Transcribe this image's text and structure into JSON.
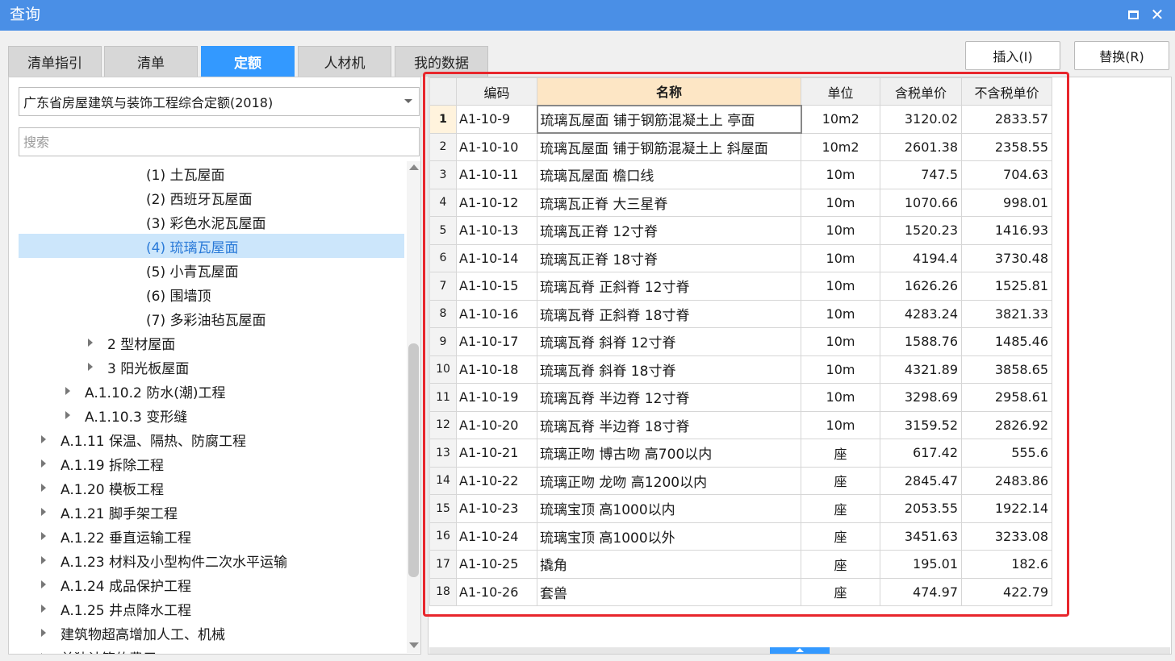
{
  "window": {
    "title": "查询"
  },
  "tabs": [
    {
      "label": "清单指引"
    },
    {
      "label": "清单"
    },
    {
      "label": "定额",
      "active": true
    },
    {
      "label": "人材机"
    },
    {
      "label": "我的数据"
    }
  ],
  "toolbar": {
    "insert_label": "插入(I)",
    "replace_label": "替换(R)"
  },
  "left": {
    "quota_library": "广东省房屋建筑与装饰工程综合定额(2018)",
    "search_placeholder": "搜索",
    "tree": [
      {
        "label": "(1) 土瓦屋面",
        "level": 3,
        "expandable": false
      },
      {
        "label": "(2) 西班牙瓦屋面",
        "level": 3,
        "expandable": false
      },
      {
        "label": "(3) 彩色水泥瓦屋面",
        "level": 3,
        "expandable": false
      },
      {
        "label": "(4) 琉璃瓦屋面",
        "level": 3,
        "expandable": false,
        "selected": true
      },
      {
        "label": "(5) 小青瓦屋面",
        "level": 3,
        "expandable": false
      },
      {
        "label": "(6) 围墙顶",
        "level": 3,
        "expandable": false
      },
      {
        "label": "(7) 多彩油毡瓦屋面",
        "level": 3,
        "expandable": false
      },
      {
        "label": "2 型材屋面",
        "level": 2,
        "expandable": true
      },
      {
        "label": "3 阳光板屋面",
        "level": 2,
        "expandable": true
      },
      {
        "label": "A.1.10.2 防水(潮)工程",
        "level": 1,
        "expandable": true
      },
      {
        "label": "A.1.10.3 变形缝",
        "level": 1,
        "expandable": true
      },
      {
        "label": "A.1.11 保温、隔热、防腐工程",
        "level": 0,
        "expandable": true
      },
      {
        "label": "A.1.19 拆除工程",
        "level": 0,
        "expandable": true
      },
      {
        "label": "A.1.20 模板工程",
        "level": 0,
        "expandable": true
      },
      {
        "label": "A.1.21 脚手架工程",
        "level": 0,
        "expandable": true
      },
      {
        "label": "A.1.22 垂直运输工程",
        "level": 0,
        "expandable": true
      },
      {
        "label": "A.1.23 材料及小型构件二次水平运输",
        "level": 0,
        "expandable": true
      },
      {
        "label": "A.1.24 成品保护工程",
        "level": 0,
        "expandable": true
      },
      {
        "label": "A.1.25 井点降水工程",
        "level": 0,
        "expandable": true
      },
      {
        "label": "建筑物超高增加人工、机械",
        "level": 0,
        "expandable": true
      },
      {
        "label": "单独计算的费用",
        "level": 0,
        "expandable": true
      }
    ]
  },
  "table": {
    "headers": [
      "编码",
      "名称",
      "单位",
      "含税单价",
      "不含税单价"
    ],
    "rows": [
      [
        "1",
        "A1-10-9",
        "琉璃瓦屋面 铺于钢筋混凝土上 亭面",
        "10m2",
        "3120.02",
        "2833.57"
      ],
      [
        "2",
        "A1-10-10",
        "琉璃瓦屋面 铺于钢筋混凝土上 斜屋面",
        "10m2",
        "2601.38",
        "2358.55"
      ],
      [
        "3",
        "A1-10-11",
        "琉璃瓦屋面 檐口线",
        "10m",
        "747.5",
        "704.63"
      ],
      [
        "4",
        "A1-10-12",
        "琉璃瓦正脊 大三星脊",
        "10m",
        "1070.66",
        "998.01"
      ],
      [
        "5",
        "A1-10-13",
        "琉璃瓦正脊 12寸脊",
        "10m",
        "1520.23",
        "1416.93"
      ],
      [
        "6",
        "A1-10-14",
        "琉璃瓦正脊 18寸脊",
        "10m",
        "4194.4",
        "3730.48"
      ],
      [
        "7",
        "A1-10-15",
        "琉璃瓦脊 正斜脊 12寸脊",
        "10m",
        "1626.26",
        "1525.81"
      ],
      [
        "8",
        "A1-10-16",
        "琉璃瓦脊 正斜脊 18寸脊",
        "10m",
        "4283.24",
        "3821.33"
      ],
      [
        "9",
        "A1-10-17",
        "琉璃瓦脊 斜脊 12寸脊",
        "10m",
        "1588.76",
        "1485.46"
      ],
      [
        "10",
        "A1-10-18",
        "琉璃瓦脊 斜脊 18寸脊",
        "10m",
        "4321.89",
        "3858.65"
      ],
      [
        "11",
        "A1-10-19",
        "琉璃瓦脊 半边脊 12寸脊",
        "10m",
        "3298.69",
        "2958.61"
      ],
      [
        "12",
        "A1-10-20",
        "琉璃瓦脊 半边脊 18寸脊",
        "10m",
        "3159.52",
        "2826.92"
      ],
      [
        "13",
        "A1-10-21",
        "琉璃正吻 博古吻 高700以内",
        "座",
        "617.42",
        "555.6"
      ],
      [
        "14",
        "A1-10-22",
        "琉璃正吻 龙吻 高1200以内",
        "座",
        "2845.47",
        "2483.86"
      ],
      [
        "15",
        "A1-10-23",
        "琉璃宝顶 高1000以内",
        "座",
        "2053.55",
        "1922.14"
      ],
      [
        "16",
        "A1-10-24",
        "琉璃宝顶 高1000以外",
        "座",
        "3451.63",
        "3233.08"
      ],
      [
        "17",
        "A1-10-25",
        "撬角",
        "座",
        "195.01",
        "182.6"
      ],
      [
        "18",
        "A1-10-26",
        "套兽",
        "座",
        "474.97",
        "422.79"
      ]
    ]
  },
  "colors": {
    "titlebar": "#4a8fe6",
    "active_tab": "#3399ff",
    "highlight_box": "#e8262c",
    "selected_tree": "#cce6fb"
  }
}
